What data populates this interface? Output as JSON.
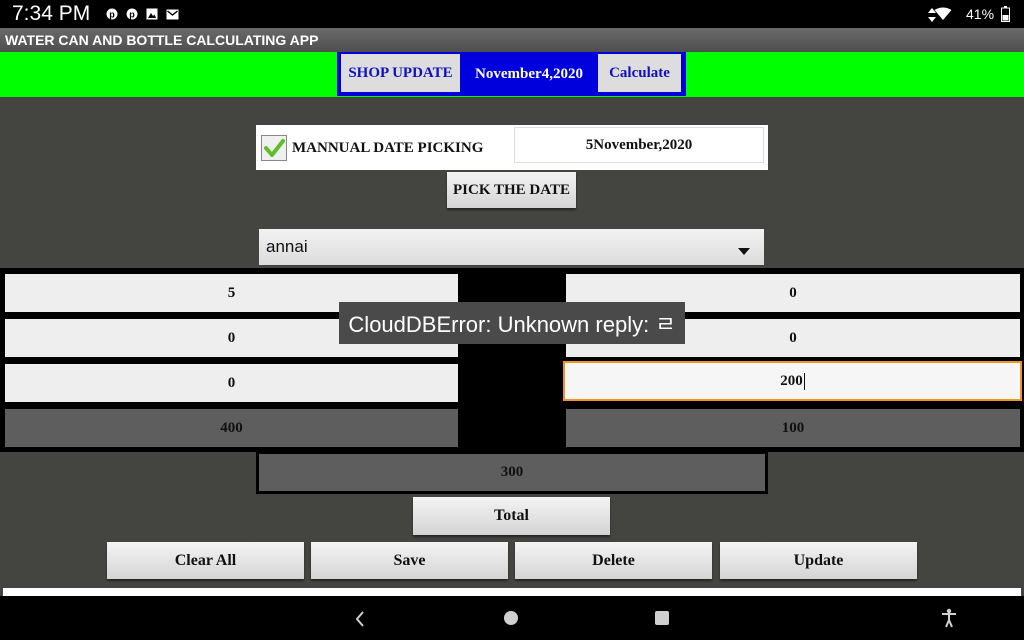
{
  "status": {
    "time": "7:34 PM",
    "battery": "41%",
    "notifications": [
      "pinterest-icon",
      "pinterest-icon",
      "image-icon",
      "mail-icon"
    ]
  },
  "app": {
    "title": "WATER CAN AND BOTTLE CALCULATING APP"
  },
  "header": {
    "shop_update": "SHOP UPDATE",
    "date": "November4,2020",
    "calculate": "Calculate"
  },
  "manual": {
    "checkbox_label": "MANNUAL DATE PICKING",
    "checked": true,
    "picked_date": "5November,2020",
    "pick_button": "PICK THE DATE"
  },
  "shop_select": {
    "value": "annai"
  },
  "grid": {
    "left": [
      "5",
      "0",
      "0"
    ],
    "right": [
      "0",
      "0",
      "200"
    ],
    "left_total": "400",
    "right_total": "100",
    "grand_total": "300"
  },
  "buttons": {
    "total": "Total",
    "clear_all": "Clear All",
    "save": "Save",
    "delete": "Delete",
    "update": "Update"
  },
  "toast": {
    "message": "CloudDBError: Unknown reply: ㄹ"
  },
  "colors": {
    "header_bg": "#00ff00",
    "header_frame": "#0000dd",
    "focus_border": "#f0961e",
    "app_bg": "#444441"
  }
}
